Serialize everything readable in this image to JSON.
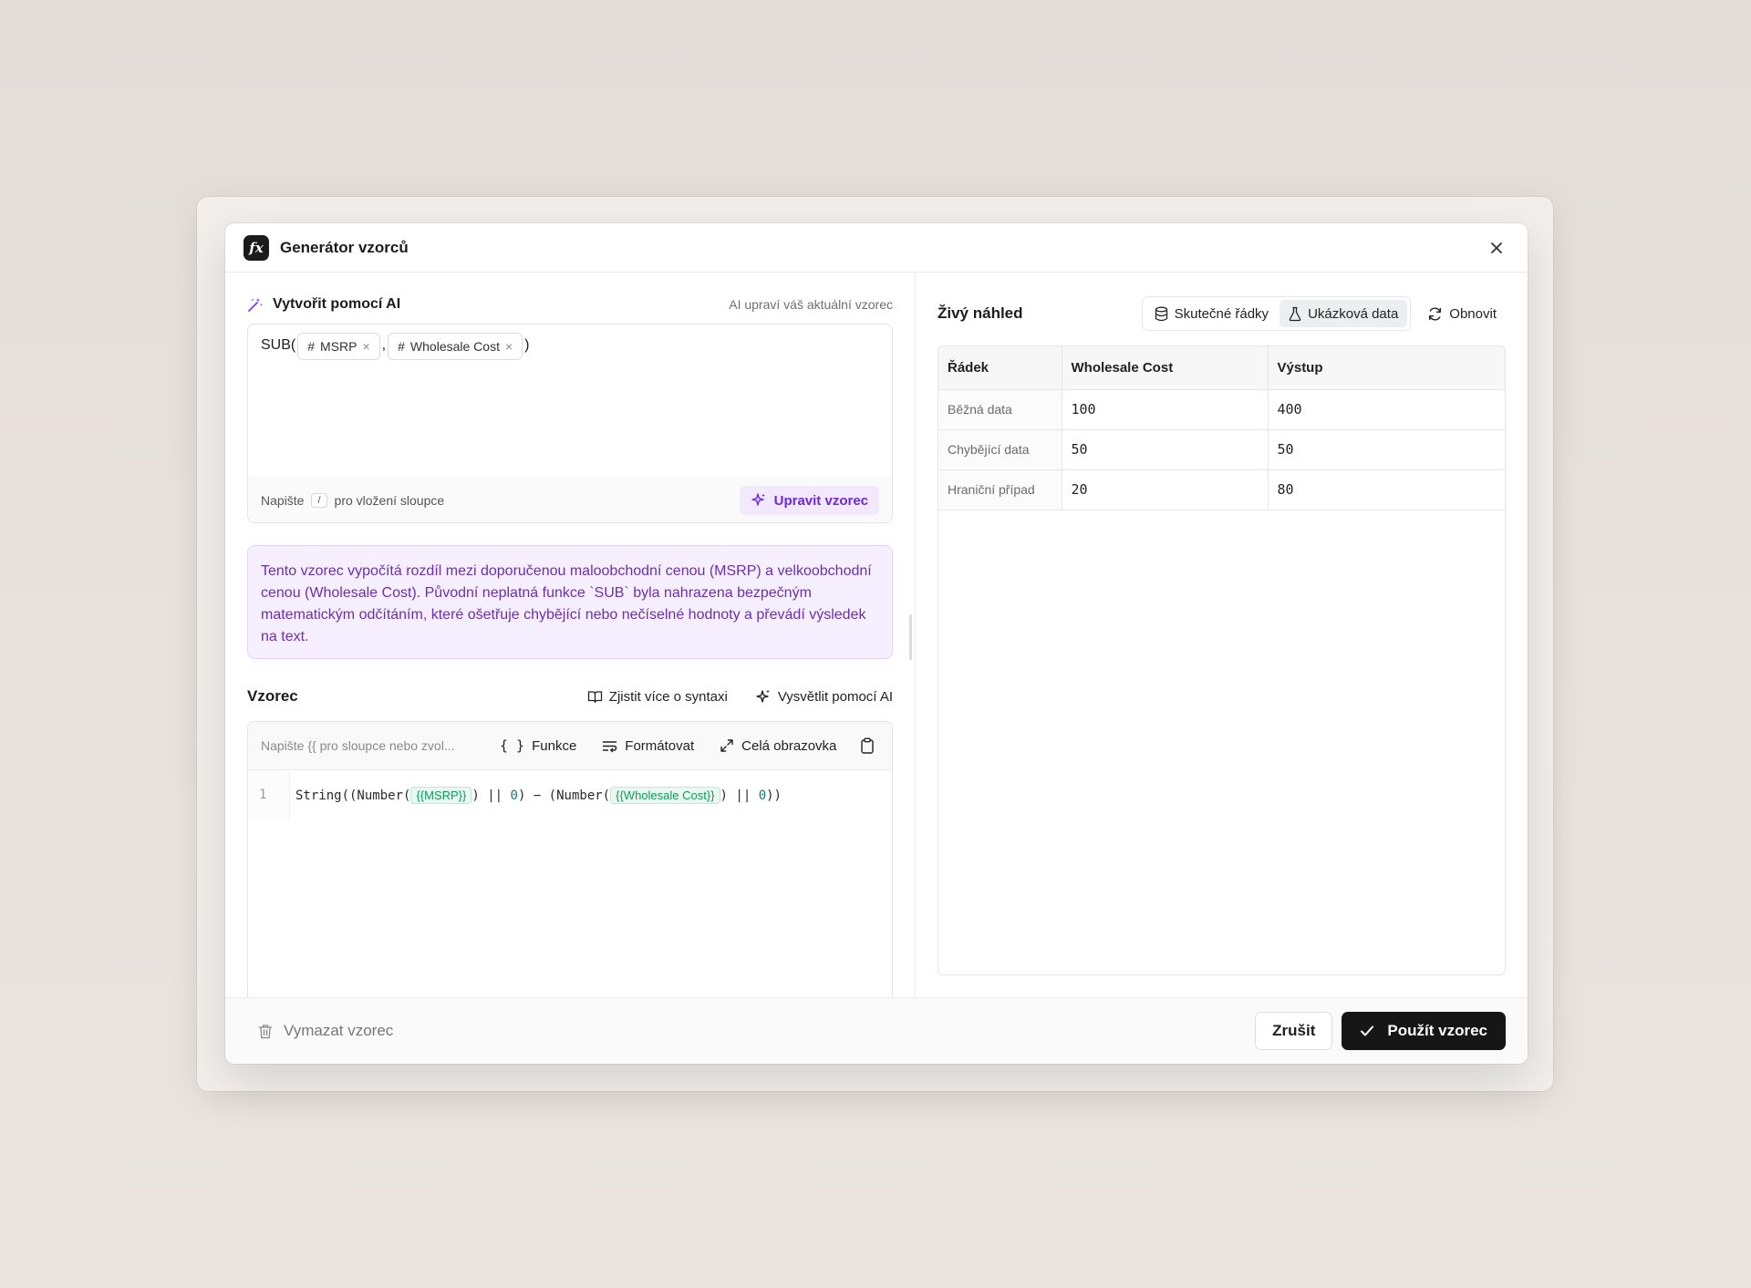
{
  "dialog": {
    "icon_label": "fx",
    "title": "Generátor vzorců"
  },
  "ai": {
    "title": "Vytvořit pomocí AI",
    "hint": "AI upraví váš aktuální vzorec",
    "prefix": "SUB(",
    "chips": [
      {
        "hash": "#",
        "label": "MSRP"
      },
      {
        "hash": "#",
        "label": "Wholesale Cost"
      }
    ],
    "separator": ",",
    "suffix": ")",
    "footer_before": "Napište",
    "footer_key": "/",
    "footer_after": "pro vložení sloupce",
    "edit_button": "Upravit vzorec"
  },
  "explanation": "Tento vzorec vypočítá rozdíl mezi doporučenou maloobchodní cenou (MSRP) a velkoobchodní cenou (Wholesale Cost). Původní neplatná funkce `SUB` byla nahrazena bezpečným matematickým odčítáním, které ošetřuje chybějící nebo nečíselné hodnoty a převádí výsledek na text.",
  "formula": {
    "title": "Vzorec",
    "learn_link": "Zjistit více o syntaxi",
    "explain_link": "Vysvětlit pomocí AI",
    "placeholder": "Napište {{ pro sloupce nebo zvol...",
    "functions_btn": "Funkce",
    "format_btn": "Formátovat",
    "fullscreen_btn": "Celá obrazovka",
    "line_number": "1",
    "code": {
      "p1": "String((Number(",
      "ref1": "{{MSRP}}",
      "p2": ") || ",
      "n1": "0",
      "p3": ") − (Number(",
      "ref2": "{{Wholesale Cost}}",
      "p4": ") || ",
      "n2": "0",
      "p5": "))"
    }
  },
  "preview": {
    "title": "Živý náhled",
    "toggle_real": "Skutečné řádky",
    "toggle_sample": "Ukázková data",
    "refresh": "Obnovit",
    "columns": [
      "Řádek",
      "Wholesale Cost",
      "Výstup"
    ],
    "rows": [
      {
        "label": "Běžná data",
        "cost": "100",
        "output": "400"
      },
      {
        "label": "Chybějící data",
        "cost": "50",
        "output": "50"
      },
      {
        "label": "Hraniční případ",
        "cost": "20",
        "output": "80"
      }
    ]
  },
  "footer": {
    "clear": "Vymazat vzorec",
    "cancel": "Zrušit",
    "apply": "Použít vzorec"
  },
  "colors": {
    "accent_purple": "#6d28d9",
    "primary_dark": "#161616",
    "ref_green": "#0c9a5f"
  }
}
